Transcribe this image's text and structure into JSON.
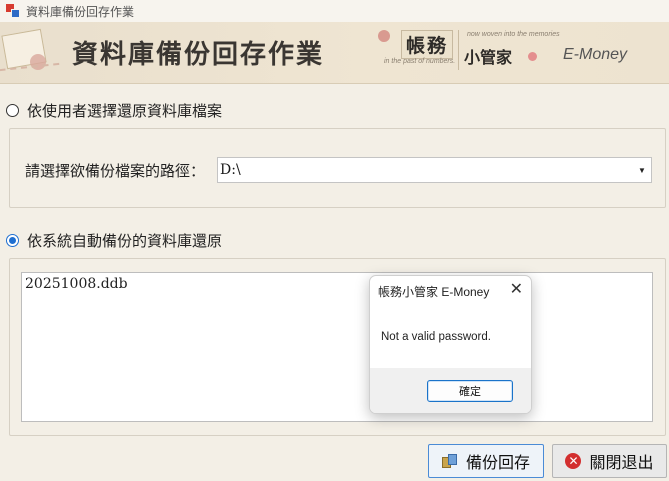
{
  "window": {
    "title": "資料庫備份回存作業"
  },
  "banner": {
    "title": "資料庫備份回存作業",
    "brand_main": "帳務",
    "brand_sub": "小管家",
    "tagline_top": "now woven into the memories",
    "tagline_bottom": "in the past of numbers.",
    "product": "E-Money"
  },
  "option_user": {
    "label": "依使用者選擇還原資料庫檔案",
    "selected": false
  },
  "path": {
    "label": "請選擇欲備份檔案的路徑：",
    "value": "D:\\"
  },
  "option_auto": {
    "label": "依系統自動備份的資料庫還原",
    "selected": true
  },
  "backup_files": [
    "20251008.ddb"
  ],
  "buttons": {
    "restore": "備份回存",
    "close": "關閉退出"
  },
  "dialog": {
    "title": "帳務小管家 E-Money",
    "message": "Not a valid password.",
    "ok": "確定",
    "close_glyph": "✕"
  },
  "colors": {
    "accent": "#1f6fd0",
    "close_icon": "#d32f2f"
  }
}
